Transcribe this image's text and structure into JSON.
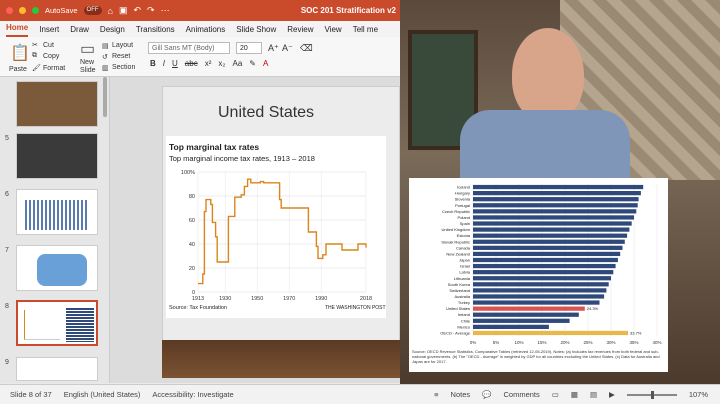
{
  "titlebar": {
    "autosave_label": "AutoSave",
    "autosave_state": "OFF",
    "doc_title": "SOC 201 Stratification v2"
  },
  "tabs": [
    "Home",
    "Insert",
    "Draw",
    "Design",
    "Transitions",
    "Animations",
    "Slide Show",
    "Review",
    "View",
    "Tell me"
  ],
  "ribbon": {
    "paste": "Paste",
    "cut": "Cut",
    "copy": "Copy",
    "format": "Format",
    "new_slide": "New\nSlide",
    "layout": "Layout",
    "reset": "Reset",
    "section": "Section",
    "font_name": "Gill Sans MT (Body)",
    "font_size": "20"
  },
  "thumbnails": {
    "numbers": [
      "5",
      "6",
      "7",
      "8",
      "9"
    ],
    "active": "8"
  },
  "slide": {
    "title": "United States",
    "chart_title": "Top marginal tax rates",
    "chart_subtitle": "Top marginal income tax rates, 1913 – 2018",
    "source": "Source: Tax Foundation",
    "brand": "THE WASHINGTON POST"
  },
  "chart_data": [
    {
      "type": "line",
      "title": "Top marginal tax rates",
      "subtitle": "Top marginal income tax rates, 1913 – 2018",
      "x_ticks": [
        "1913",
        "1930",
        "1950",
        "1970",
        "1990",
        "2018"
      ],
      "y_ticks": [
        "0",
        "20",
        "40",
        "60",
        "80",
        "100%"
      ],
      "ylim": [
        0,
        100
      ],
      "xlim": [
        1913,
        2018
      ],
      "color": "#d9861c",
      "x": [
        1913,
        1916,
        1917,
        1918,
        1921,
        1922,
        1924,
        1925,
        1931,
        1932,
        1936,
        1940,
        1941,
        1942,
        1944,
        1946,
        1951,
        1952,
        1954,
        1964,
        1965,
        1982,
        1987,
        1988,
        1991,
        1993,
        2003,
        2013,
        2018
      ],
      "y": [
        7,
        15,
        67,
        77,
        73,
        58,
        46,
        25,
        25,
        63,
        79,
        81,
        81,
        88,
        94,
        91,
        91,
        92,
        91,
        77,
        70,
        50,
        38,
        28,
        31,
        40,
        35,
        40,
        37
      ]
    },
    {
      "type": "bar",
      "orientation": "horizontal",
      "categories": [
        "Iceland",
        "Hungary",
        "Slovenia",
        "Portugal",
        "Czech Republic",
        "Poland",
        "Spain",
        "United Kingdom",
        "Estonia",
        "Slovak Republic",
        "Canada",
        "New Zealand",
        "Japan",
        "Israel",
        "Latvia",
        "Lithuania",
        "South Korea",
        "Switzerland",
        "Australia",
        "Turkey",
        "United States",
        "Ireland",
        "Chile",
        "Mexico",
        "OECD - Average"
      ],
      "values": [
        37,
        36.5,
        36,
        35.8,
        35.5,
        35,
        34.5,
        34,
        33.5,
        33,
        32.5,
        32,
        31.5,
        31,
        30.5,
        30,
        29.5,
        29,
        28.5,
        27.5,
        24.3,
        23,
        21,
        16.5,
        33.7
      ],
      "highlight": {
        "United States": "#d9534f",
        "OECD - Average": "#e8b84a"
      },
      "data_labels": {
        "United States": "24.3%",
        "OECD - Average": "33.7%"
      },
      "x_ticks": [
        "0%",
        "5%",
        "10%",
        "15%",
        "20%",
        "25%",
        "30%",
        "35%",
        "40%"
      ],
      "xlim": [
        0,
        40
      ],
      "bar_color": "#2f4a7a",
      "source": "Source: OECD Revenue Statistics, Comparative Tables (retrieved 12-05-2019). Notes: (a) Includes tax revenues from both federal and sub-national governments. (b) The \"OECD - Average\" is weighted by GDP for all countries excluding the United States. (c) Data for Australia and Japan are for 2017."
    }
  ],
  "status": {
    "slide_info": "Slide 8 of 37",
    "language": "English (United States)",
    "accessibility": "Accessibility: Investigate",
    "notes": "Notes",
    "comments": "Comments",
    "zoom": "107%"
  }
}
